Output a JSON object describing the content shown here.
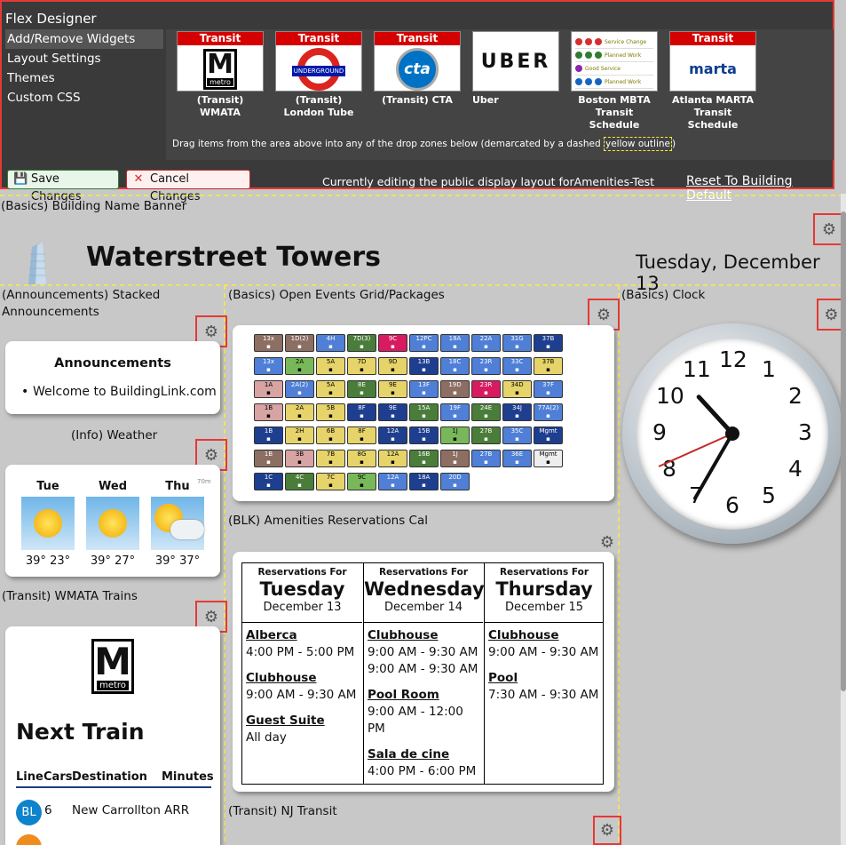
{
  "designer": {
    "title": "Flex Designer",
    "menu": [
      "Add/Remove Widgets",
      "Layout Settings",
      "Themes",
      "Custom CSS"
    ],
    "tiles": [
      {
        "band": "Transit",
        "caption": "(Transit) WMATA",
        "logo": "M",
        "logo_sub": "metro"
      },
      {
        "band": "Transit",
        "caption": "(Transit) London Tube",
        "logo": "UNDERGROUND"
      },
      {
        "band": "Transit",
        "caption": "(Transit) CTA",
        "logo": "cta"
      },
      {
        "band": "",
        "caption": "Uber",
        "logo": "UBER"
      },
      {
        "band": "",
        "caption": "Boston MBTA Transit Schedule",
        "mbta_rows": [
          "Service Change",
          "Planned Work",
          "Good Service",
          "Planned Work"
        ]
      },
      {
        "band": "Transit",
        "caption": "Atlanta MARTA Transit Schedule",
        "logo": "marta"
      }
    ],
    "hint_before": "Drag items from the area above into any of the drop zones below (demarcated by a dashed ",
    "hint_highlight": "yellow outline",
    "hint_after": ")",
    "save_label": "Save Changes",
    "cancel_label": "Cancel Changes",
    "editing_text": "Currently editing the public display layout forAmenities-Test",
    "reset_label": "Reset To Building Default"
  },
  "banner": {
    "zone_label": "(Basics) Building Name Banner",
    "title": "Waterstreet Towers",
    "date": "Tuesday, December 13"
  },
  "announcements": {
    "zone_label": "(Announcements) Stacked Announcements",
    "heading": "Announcements",
    "items": [
      "Welcome to BuildingLink.com"
    ]
  },
  "weather": {
    "zone_label": "(Info) Weather",
    "days": [
      {
        "day": "Tue",
        "temp": "39° 23°"
      },
      {
        "day": "Wed",
        "temp": "39° 27°"
      },
      {
        "day": "Thu",
        "temp": "39° 37°",
        "badge": "70m"
      }
    ]
  },
  "wmata": {
    "zone_label": "(Transit) WMATA Trains",
    "logo": "M",
    "logo_sub": "metro",
    "next_train": "Next Train",
    "headers": [
      "Line",
      "Cars",
      "Destination",
      "Minutes"
    ],
    "rows": [
      {
        "line": "BL",
        "cars": "6",
        "destination": "New Carrollton ARR"
      }
    ]
  },
  "events": {
    "zone_label": "(Basics) Open Events Grid/Packages",
    "grid": [
      [
        "13x",
        "1D(2)",
        "4H",
        "7D(3)",
        "9C",
        "12PC",
        "18A",
        "22A",
        "31G",
        "37B"
      ],
      [
        "13x",
        "2A",
        "5A",
        "7D",
        "9D",
        "13B",
        "18C",
        "23R",
        "33C",
        "37B"
      ],
      [
        "1A",
        "2A(2)",
        "5A",
        "8E",
        "9E",
        "13F",
        "19D",
        "23R",
        "34D",
        "37F"
      ],
      [
        "1B",
        "2A",
        "5B",
        "8F",
        "9E",
        "15A",
        "19F",
        "24E",
        "34J",
        "77A(2)"
      ],
      [
        "1B",
        "2H",
        "6B",
        "8F",
        "12A",
        "15B",
        "1J",
        "27B",
        "35C",
        "Mgmt"
      ],
      [
        "1B",
        "3B",
        "7B",
        "8G",
        "12A",
        "16B",
        "1J",
        "27B",
        "36E",
        "Mgmt"
      ],
      [
        "1C",
        "4C",
        "7C",
        "9C",
        "12A",
        "18A",
        "20D"
      ]
    ],
    "grid_colors": [
      [
        "#8d6e63",
        "#8d6e63",
        "#4f7fd6",
        "#4a7d3a",
        "#d81b60",
        "#4f7fd6",
        "#4f7fd6",
        "#4f7fd6",
        "#4f7fd6",
        "#1e3f8f"
      ],
      [
        "#4f7fd6",
        "#79b85a",
        "#e6d46b",
        "#e6d46b",
        "#e6d46b",
        "#1e3f8f",
        "#4f7fd6",
        "#4f7fd6",
        "#4f7fd6",
        "#e6d46b"
      ],
      [
        "#d7a3a3",
        "#4f7fd6",
        "#e6d46b",
        "#4a7d3a",
        "#e6d46b",
        "#4f7fd6",
        "#8d6e63",
        "#d81b60",
        "#e6d46b",
        "#4f7fd6"
      ],
      [
        "#d7a3a3",
        "#e6d46b",
        "#e6d46b",
        "#1e3f8f",
        "#1e3f8f",
        "#4a7d3a",
        "#4f7fd6",
        "#4a7d3a",
        "#1e3f8f",
        "#4f7fd6"
      ],
      [
        "#1e3f8f",
        "#e6d46b",
        "#e6d46b",
        "#e6d46b",
        "#1e3f8f",
        "#1e3f8f",
        "#79b85a",
        "#4a7d3a",
        "#4f7fd6",
        "#1e3f8f"
      ],
      [
        "#8d6e63",
        "#d7a3a3",
        "#e6d46b",
        "#e6d46b",
        "#e6d46b",
        "#4a7d3a",
        "#8d6e63",
        "#4f7fd6",
        "#4f7fd6",
        "#eeeeee"
      ],
      [
        "#1e3f8f",
        "#4a7d3a",
        "#e6d46b",
        "#79b85a",
        "#4f7fd6",
        "#1e3f8f",
        "#4f7fd6"
      ]
    ]
  },
  "reservations": {
    "zone_label": "(BLK) Amenities Reservations Cal",
    "columns": [
      {
        "for": "Reservations For",
        "day": "Tuesday",
        "date": "December 13",
        "entries": [
          {
            "room": "Alberca",
            "times": [
              "4:00 PM - 5:00 PM"
            ]
          },
          {
            "room": "Clubhouse",
            "times": [
              "9:00 AM - 9:30 AM"
            ]
          },
          {
            "room": "Guest Suite",
            "times": [
              "All day"
            ]
          }
        ]
      },
      {
        "for": "Reservations For",
        "day": "Wednesday",
        "date": "December 14",
        "entries": [
          {
            "room": "Clubhouse",
            "times": [
              "9:00 AM - 9:30 AM",
              "9:00 AM - 9:30 AM"
            ]
          },
          {
            "room": "Pool Room",
            "times": [
              "9:00 AM - 12:00 PM"
            ]
          },
          {
            "room": "Sala de cine",
            "times": [
              "4:00 PM - 6:00 PM"
            ]
          }
        ]
      },
      {
        "for": "Reservations For",
        "day": "Thursday",
        "date": "December 15",
        "entries": [
          {
            "room": "Clubhouse",
            "times": [
              "9:00 AM - 9:30 AM"
            ]
          },
          {
            "room": "Pool",
            "times": [
              "7:30 AM - 9:30 AM"
            ]
          }
        ]
      }
    ]
  },
  "clock": {
    "zone_label": "(Basics) Clock",
    "numbers": [
      "12",
      "1",
      "2",
      "3",
      "4",
      "5",
      "6",
      "7",
      "8",
      "9",
      "10",
      "11"
    ],
    "time": {
      "hour": 10,
      "minute": 35,
      "second": 41
    }
  },
  "nj_transit": {
    "zone_label": "(Transit) NJ Transit"
  },
  "colors": {
    "highlight_red": "#e53935",
    "zone_yellow": "#ffeb3b",
    "wmata_blue": "#0e83cd"
  }
}
